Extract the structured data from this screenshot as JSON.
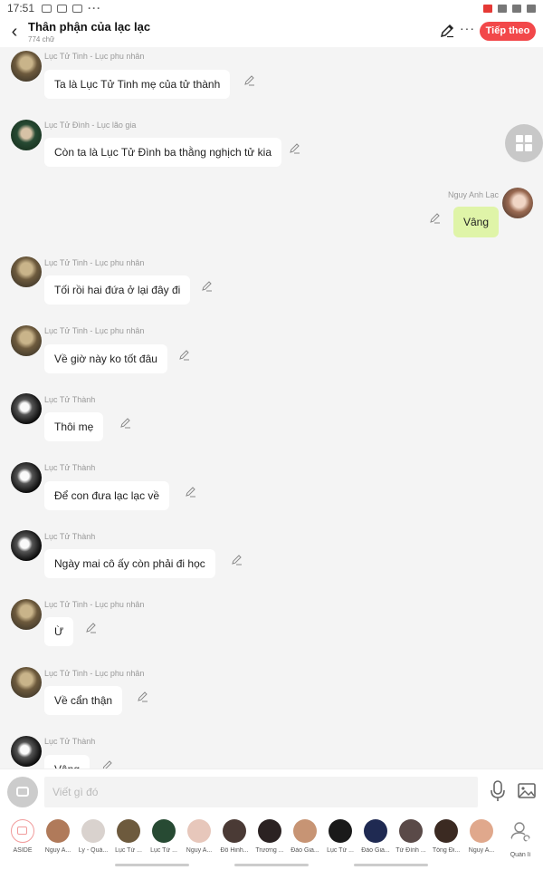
{
  "status_bar": {
    "time": "17:51",
    "more": "···"
  },
  "header": {
    "title": "Thân phận của lạc lạc",
    "subtitle": "774 chữ",
    "more": "···",
    "next_label": "Tiếp theo"
  },
  "messages": [
    {
      "sender": "Lục Tử Tinh - Lục phu nhân",
      "text": "Ta là Lục Tử Tinh mẹ của tử thành",
      "avatar": "tinh"
    },
    {
      "sender": "Lục Tử Đình - Lục lão gia",
      "text": "Còn ta là Lục Tử Đình ba thằng nghịch tử kia",
      "avatar": "dinh"
    },
    {
      "sender": "Nguy Anh Lạc",
      "text": "Vâng",
      "avatar": "me"
    },
    {
      "sender": "Lục Tử Tinh - Lục phu nhân",
      "text": "Tối rồi hai đứa ở lại đây đi",
      "avatar": "tinh"
    },
    {
      "sender": "Lục Tử Tinh - Lục phu nhân",
      "text": "Về giờ này ko tốt đâu",
      "avatar": "tinh"
    },
    {
      "sender": "Lục Tử Thành",
      "text": "Thôi mẹ",
      "avatar": "thanh"
    },
    {
      "sender": "Lục Tử Thành",
      "text": "Để con đưa lạc lạc về",
      "avatar": "thanh"
    },
    {
      "sender": "Lục Tử Thành",
      "text": "Ngày mai cô ấy còn phải đi học",
      "avatar": "thanh"
    },
    {
      "sender": "Lục Tử Tinh - Lục phu nhân",
      "text": "Ừ",
      "avatar": "tinh"
    },
    {
      "sender": "Lục Tử Tinh - Lục phu nhân",
      "text": "Về cẩn thận",
      "avatar": "tinh"
    },
    {
      "sender": "Lục Tử Thành",
      "text": "Vâng",
      "avatar": "thanh"
    }
  ],
  "input": {
    "placeholder": "Viết gì đó"
  },
  "characters": [
    {
      "label": "ASIDE",
      "color": "#ffffff"
    },
    {
      "label": "Nguy A...",
      "color": "#b07a5a"
    },
    {
      "label": "Ly - Quả...",
      "color": "#d9d2ce"
    },
    {
      "label": "Lục Tử ...",
      "color": "#6d5a3d"
    },
    {
      "label": "Lục Tử ...",
      "color": "#274a33"
    },
    {
      "label": "Nguy A...",
      "color": "#e7c7bb"
    },
    {
      "label": "Đỗ Hinh...",
      "color": "#4a3a35"
    },
    {
      "label": "Trương ...",
      "color": "#2b2222"
    },
    {
      "label": "Đào Gia...",
      "color": "#c79474"
    },
    {
      "label": "Lục Tử ...",
      "color": "#1a1a1a"
    },
    {
      "label": "Đào Gia...",
      "color": "#1f2a52"
    },
    {
      "label": "Tử Đình ...",
      "color": "#5a4a48"
    },
    {
      "label": "Tống Đi...",
      "color": "#3b2a22"
    },
    {
      "label": "Nguy A...",
      "color": "#e0a88c"
    },
    {
      "label": "Quản lí",
      "color": "#ffffff"
    }
  ]
}
